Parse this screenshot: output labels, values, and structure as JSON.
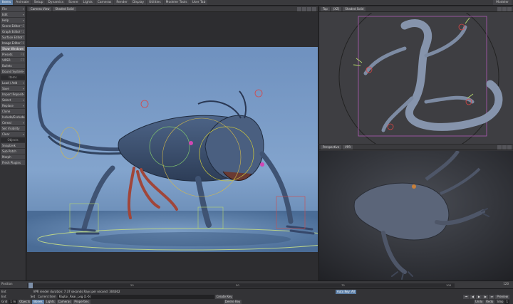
{
  "top_tabs": [
    "Items",
    "Animate",
    "Setup",
    "Dynamics",
    "Scene",
    "Lights",
    "Cameras",
    "Render",
    "Display",
    "Utilities",
    "Modeler Tools",
    "User Tab"
  ],
  "top_right_label": "Modeler",
  "left_panel": {
    "items": [
      {
        "label": "File",
        "key": "▾"
      },
      {
        "label": "Edit",
        "key": "▾"
      },
      {
        "label": "Help",
        "key": "▾"
      },
      {
        "label": "Scene Editor",
        "key": "^E"
      },
      {
        "label": "Graph Editor",
        "key": "^F2"
      },
      {
        "label": "Surface Editor",
        "key": "F5"
      },
      {
        "label": "Image Editor",
        "key": "F6"
      },
      {
        "label": "Show Windows",
        "key": "▾"
      },
      {
        "label": "Presets",
        "key": "F8"
      },
      {
        "label": "VIPER",
        "key": "F7"
      },
      {
        "label": "Bullets",
        "key": ""
      },
      {
        "label": "Dound System",
        "key": "▾"
      }
    ],
    "items_header": "Items",
    "items2": [
      {
        "label": "Load / Add",
        "key": "▾"
      },
      {
        "label": "Save",
        "key": "▾"
      },
      {
        "label": "Import Reposit",
        "key": "▾"
      },
      {
        "label": "Select",
        "key": "▾"
      },
      {
        "label": "Replace",
        "key": "▾"
      },
      {
        "label": "Clone",
        "key": ""
      },
      {
        "label": "Include/Exclude",
        "key": "▾"
      },
      {
        "label": "Cereal",
        "key": "▾"
      },
      {
        "label": "Set Visibility",
        "key": ""
      },
      {
        "label": "Clear",
        "key": "▾"
      }
    ],
    "objects_header": "Objects",
    "items3": [
      {
        "label": "Snapbrek",
        "key": ""
      },
      {
        "label": "Sub Patch",
        "key": ""
      },
      {
        "label": "Morph",
        "key": ""
      },
      {
        "label": "Flesh Plugins",
        "key": ""
      }
    ]
  },
  "main_viewport": {
    "view_select": "Camera View",
    "shading_select": "Shaded Solid"
  },
  "top_viewport": {
    "view_select": "Top",
    "axis_select": "(XZ)",
    "shading_select": "Shaded Solid"
  },
  "persp_viewport": {
    "view_select": "Perspective",
    "shading_select": "VPR"
  },
  "timeline": {
    "label": "Position",
    "ticks": [
      "0",
      "25",
      "50",
      "75",
      "100",
      "60"
    ],
    "frame_readout": "120"
  },
  "bottom_bar": {
    "row1": {
      "label": "Ent",
      "status": "VPR render duration: 7.37 seconds  Rays per second: 304362",
      "auto_key": "Auto Key: All"
    },
    "row2": {
      "label": "Ent",
      "set_label": "Set",
      "current_item_label": "Current Item",
      "current_item_value": "Raptor_Rear_Leg (1-6)",
      "create_key": "Create Key",
      "preview": "Preview"
    },
    "row3": {
      "label": "Grid",
      "grid_value": "1 m",
      "objects": "Objects",
      "bones": "Bones",
      "lights": "Lights",
      "cameras": "Cameras",
      "properties": "Properties",
      "delete_key": "Delete Key",
      "undo": "Undo",
      "redo": "Redo",
      "step_label": "Step",
      "step_value": "1"
    }
  },
  "colors": {
    "accent": "#5d7fa6",
    "panel": "#333336",
    "viewport_sky_top": "#6d8fbd",
    "viewport_floor": "#4a6e97"
  }
}
